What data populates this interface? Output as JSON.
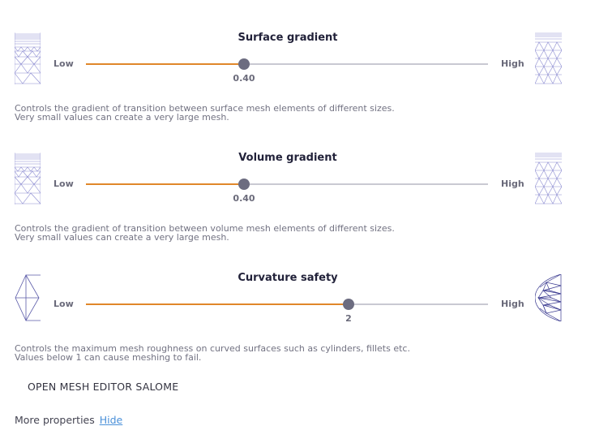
{
  "sliders": [
    {
      "title": "Surface gradient",
      "low_label": "Low",
      "high_label": "High",
      "value_text": "0.40",
      "fraction": 0.393,
      "description_line1": "Controls the gradient of transition between surface mesh elements of different sizes.",
      "description_line2": "Very small values can create a very large mesh.",
      "low_icon": "fine-graded-mesh-icon",
      "high_icon": "uniform-mesh-icon"
    },
    {
      "title": "Volume gradient",
      "low_label": "Low",
      "high_label": "High",
      "value_text": "0.40",
      "fraction": 0.393,
      "description_line1": "Controls the gradient of transition between volume mesh elements of different sizes.",
      "description_line2": "Very small values can create a very large mesh.",
      "low_icon": "fine-graded-mesh-icon",
      "high_icon": "uniform-mesh-icon"
    },
    {
      "title": "Curvature safety",
      "low_label": "Low",
      "high_label": "High",
      "value_text": "2",
      "fraction": 0.653,
      "description_line1": "Controls the maximum mesh roughness on curved surfaces such as cylinders, fillets etc.",
      "description_line2": "Values below 1 can cause meshing to fail.",
      "low_icon": "coarse-curve-mesh-icon",
      "high_icon": "fine-curve-mesh-icon"
    }
  ],
  "open_editor_label": "OPEN MESH EDITOR SALOME",
  "more_properties_label": "More properties",
  "hide_label": "Hide",
  "colors": {
    "accent": "#e0872a",
    "track": "#c9c9d2",
    "knob": "#6c6c80",
    "mesh_line": "#8a8ad0",
    "link": "#4a90d9"
  }
}
